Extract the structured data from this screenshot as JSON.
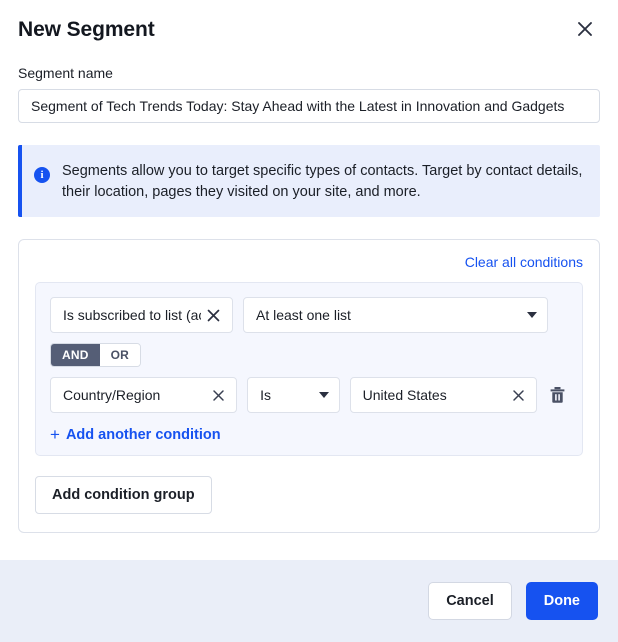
{
  "dialog": {
    "title": "New Segment",
    "close_icon": "close-icon"
  },
  "segment_name": {
    "label": "Segment name",
    "value": "Segment of Tech Trends Today: Stay Ahead with the Latest in Innovation and Gadgets",
    "placeholder": "Segment name"
  },
  "info_banner": {
    "icon": "info-icon",
    "text": "Segments allow you to target specific types of contacts. Target by contact details, their location, pages they visited on your site, and more."
  },
  "conditions": {
    "clear_all_label": "Clear all conditions",
    "add_condition_label": "Add another condition",
    "add_condition_icon": "plus-icon",
    "add_group_label": "Add condition group",
    "operator_toggle": {
      "and_label": "AND",
      "or_label": "OR",
      "selected": "AND"
    },
    "rows": [
      {
        "field": "Is subscribed to list (act..",
        "field_clear_icon": "close-icon",
        "operator": "At least one list",
        "operator_caret_icon": "chevron-down-icon"
      },
      {
        "field": "Country/Region",
        "field_clear_icon": "close-icon",
        "operator": "Is",
        "operator_caret_icon": "chevron-down-icon",
        "value": "United States",
        "value_clear_icon": "close-icon",
        "delete_icon": "trash-icon"
      }
    ]
  },
  "footer": {
    "cancel_label": "Cancel",
    "done_label": "Done"
  },
  "colors": {
    "accent_blue": "#1652f0",
    "info_bg": "#e9eefc",
    "group_bg": "#f5f7fe",
    "footer_bg": "#eaeef8",
    "toggle_active_bg": "#555e76"
  }
}
